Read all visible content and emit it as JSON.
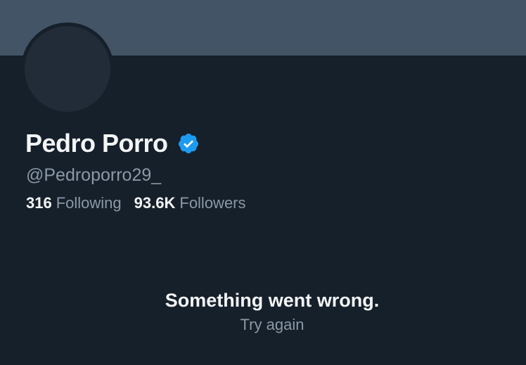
{
  "profile": {
    "display_name": "Pedro Porro",
    "handle": "@Pedroporro29_",
    "verified": true,
    "verified_badge_color": "#1d9bf0"
  },
  "stats": {
    "following_count": "316",
    "following_label": "Following",
    "followers_count": "93.6K",
    "followers_label": "Followers"
  },
  "error": {
    "message": "Something went wrong.",
    "retry_label": "Try again"
  },
  "colors": {
    "background": "#15202b",
    "banner": "#425466",
    "secondary_text": "#8b98a5"
  }
}
